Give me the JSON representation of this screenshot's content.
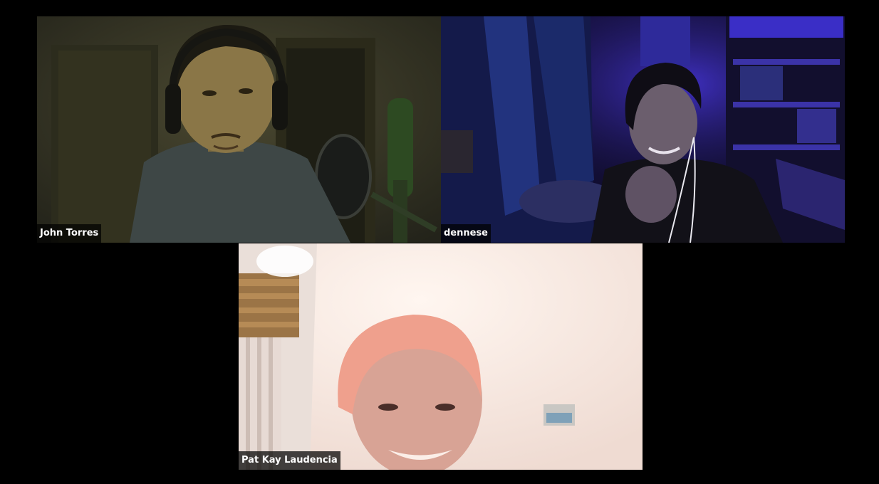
{
  "meeting": {
    "participants": [
      {
        "name": "John Torres",
        "colors": {
          "background": "#3b3a26",
          "door": "#2e2d1c",
          "shirt": "#3f4a47",
          "skin": "#8a7646",
          "hair": "#1c1a12",
          "mic": "#27401f"
        }
      },
      {
        "name": "dennese",
        "colors": {
          "background": "#1a1447",
          "light": "#3f2fd1",
          "curtain": "#20337a",
          "shirt": "#131219",
          "skin": "#6a5d6b",
          "hair": "#0e0c14"
        }
      },
      {
        "name": "Pat Kay Laudencia",
        "colors": {
          "background": "#f3e5df",
          "wall_left": "#e9d7cd",
          "blinds": "#9b7445",
          "hair": "#efa08d",
          "skin": "#d8a394"
        }
      }
    ]
  }
}
